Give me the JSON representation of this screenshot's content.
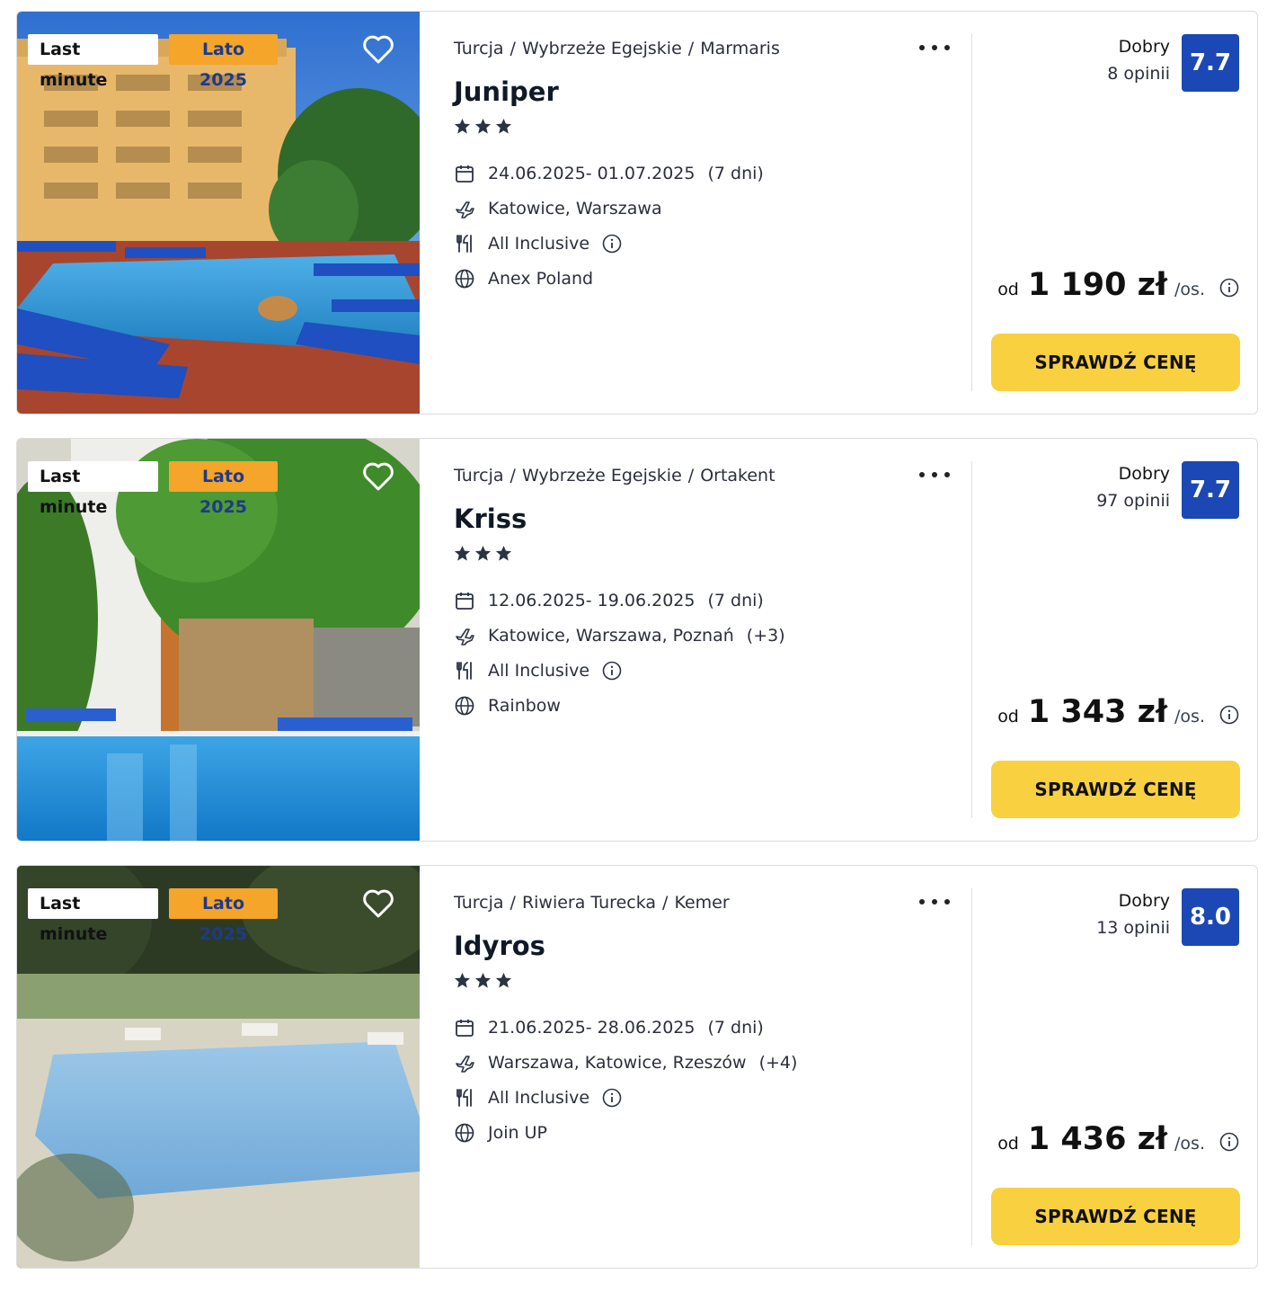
{
  "offers": [
    {
      "badges": {
        "last_minute": "Last minute",
        "season": "Lato 2025"
      },
      "breadcrumb": {
        "country": "Turcja",
        "region": "Wybrzeże Egejskie",
        "city": "Marmaris",
        "separator": "/"
      },
      "name": "Juniper",
      "stars": 3,
      "dates": "24.06.2025- 01.07.2025",
      "duration": "(7 dni)",
      "departures": "Katowice, Warszawa",
      "departures_extra": "",
      "board": "All Inclusive",
      "operator": "Anex Poland",
      "rating_label": "Dobry",
      "reviews": "8 opinii",
      "score": "7.7",
      "price_prefix": "od",
      "price": "1 190 zł",
      "price_unit": "/os.",
      "cta": "SPRAWDŹ CENĘ"
    },
    {
      "badges": {
        "last_minute": "Last minute",
        "season": "Lato 2025"
      },
      "breadcrumb": {
        "country": "Turcja",
        "region": "Wybrzeże Egejskie",
        "city": "Ortakent",
        "separator": "/"
      },
      "name": "Kriss",
      "stars": 3,
      "dates": "12.06.2025- 19.06.2025",
      "duration": "(7 dni)",
      "departures": "Katowice, Warszawa, Poznań",
      "departures_extra": "(+3)",
      "board": "All Inclusive",
      "operator": "Rainbow",
      "rating_label": "Dobry",
      "reviews": "97 opinii",
      "score": "7.7",
      "price_prefix": "od",
      "price": "1 343 zł",
      "price_unit": "/os.",
      "cta": "SPRAWDŹ CENĘ"
    },
    {
      "badges": {
        "last_minute": "Last minute",
        "season": "Lato 2025"
      },
      "breadcrumb": {
        "country": "Turcja",
        "region": "Riwiera Turecka",
        "city": "Kemer",
        "separator": "/"
      },
      "name": "Idyros",
      "stars": 3,
      "dates": "21.06.2025- 28.06.2025",
      "duration": "(7 dni)",
      "departures": "Warszawa, Katowice, Rzeszów",
      "departures_extra": "(+4)",
      "board": "All Inclusive",
      "operator": "Join UP",
      "rating_label": "Dobry",
      "reviews": "13 opinii",
      "score": "8.0",
      "price_prefix": "od",
      "price": "1 436 zł",
      "price_unit": "/os.",
      "cta": "SPRAWDŹ CENĘ"
    }
  ],
  "colors": {
    "score_bg": "#1b48b4",
    "cta_bg": "#f8d040",
    "season_badge_bg": "#f4a52a",
    "season_badge_text": "#1e3a8a"
  },
  "icons": {
    "favorite": "heart-icon",
    "more": "more-dots-icon",
    "dates": "calendar-icon",
    "departures": "plane-icon",
    "board": "cutlery-icon",
    "operator": "globe-icon",
    "info": "info-icon",
    "stars": "star-icon"
  }
}
